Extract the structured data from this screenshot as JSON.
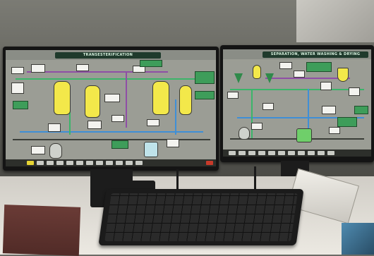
{
  "left_monitor": {
    "title": "TRANSESTERIFICATION"
  },
  "right_monitor": {
    "title": "SEPARATION, WATER WASHING & DRYING"
  },
  "colors": {
    "reactor_yellow": "#f3e84a",
    "pipe_green": "#3bb56a",
    "pipe_purple": "#8f4fa6",
    "pipe_blue": "#3f8fd6",
    "title_bar": "#1f3a2c",
    "screen_bg": "#9b9d95"
  },
  "icons": [
    "reactor-vessel-icon",
    "separator-cone-icon",
    "tank-icon",
    "pump-icon",
    "valve-icon"
  ]
}
